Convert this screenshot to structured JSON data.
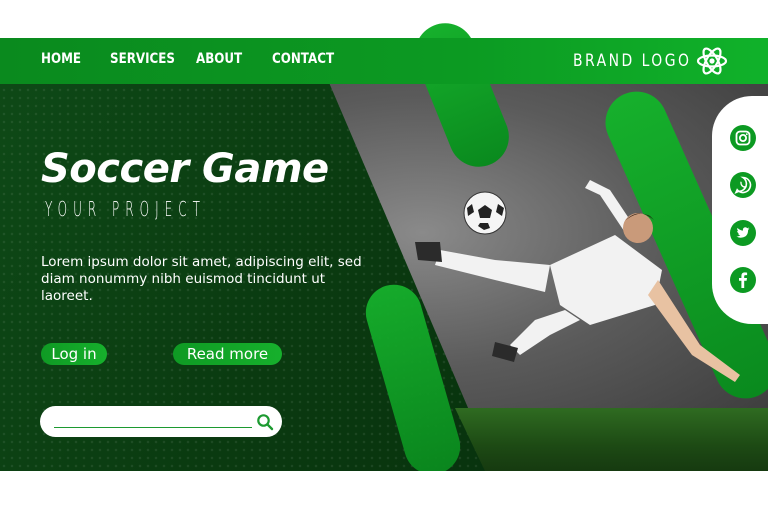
{
  "nav": {
    "items": [
      {
        "label": "HOME"
      },
      {
        "label": "SERVICES"
      },
      {
        "label": "ABOUT"
      },
      {
        "label": "CONTACT"
      }
    ],
    "brand": "BRAND LOGO"
  },
  "hero": {
    "title": "Soccer Game",
    "subtitle": "YOUR PROJECT",
    "body": "Lorem ipsum dolor sit amet, adipiscing elit, sed diam nonummy nibh euismod tincidunt ut laoreet."
  },
  "buttons": {
    "login": "Log in",
    "read_more": "Read more"
  },
  "search": {
    "placeholder": ""
  },
  "social": [
    "instagram-icon",
    "whatsapp-icon",
    "twitter-icon",
    "facebook-icon"
  ],
  "colors": {
    "accent": "#16b02c",
    "dark": "#0a3a10",
    "nav": "#0c9a22"
  }
}
